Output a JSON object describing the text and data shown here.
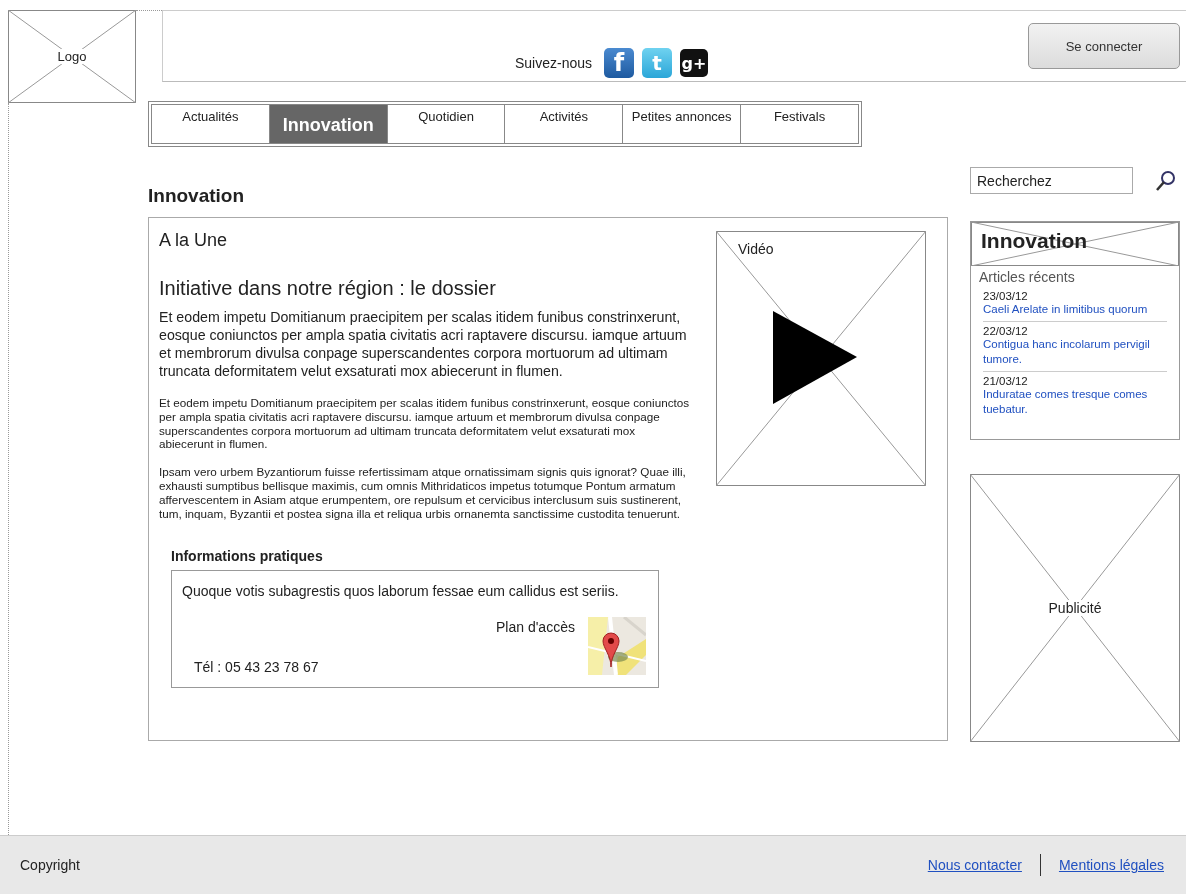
{
  "header": {
    "logo": "Logo",
    "follow_label": "Suivez-nous",
    "social": [
      {
        "kind": "facebook",
        "glyph": "f"
      },
      {
        "kind": "twitter",
        "glyph": "t"
      },
      {
        "kind": "googleplus",
        "glyph": "g+"
      }
    ],
    "login_button": "Se connecter"
  },
  "nav": {
    "tabs": [
      {
        "label": "Actualités",
        "selected": false
      },
      {
        "label": "Innovation",
        "selected": true
      },
      {
        "label": "Quotidien",
        "selected": false
      },
      {
        "label": "Activités",
        "selected": false
      },
      {
        "label": "Petites annonces",
        "selected": false
      },
      {
        "label": "Festivals",
        "selected": false
      }
    ]
  },
  "page_title": "Innovation",
  "main": {
    "section": "A la Une",
    "headline": "Initiative dans notre région : le dossier",
    "lead": "Et eodem impetu Domitianum praecipitem per scalas itidem funibus constrinxerunt, eosque coniunctos per ampla spatia civitatis acri raptavere discursu. iamque artuum et membrorum divulsa conpage superscandentes corpora mortuorum ad ultimam truncata deformitatem velut exsaturati mox abiecerunt in flumen.",
    "paragraphs": [
      "Et eodem impetu Domitianum praecipitem per scalas itidem funibus constrinxerunt, eosque coniunctos per ampla spatia civitatis acri raptavere discursu. iamque artuum et membrorum divulsa conpage superscandentes corpora mortuorum ad ultimam truncata deformitatem velut exsaturati mox abiecerunt in flumen.",
      "Ipsam vero urbem Byzantiorum fuisse refertissimam atque ornatissimam signis quis ignorat? Quae illi, exhausti sumptibus bellisque maximis, cum omnis Mithridaticos impetus totumque Pontum armatum affervescentem in Asiam atque erumpentem, ore repulsum et cervicibus interclusum suis sustinerent, tum, inquam, Byzantii et postea signa illa et reliqua urbis ornanemta sanctissime custodita tenuerunt."
    ],
    "video_label": "Vidéo",
    "info": {
      "title": "Informations pratiques",
      "text": "Quoque votis subagrestis quos laborum fessae eum callidus est seriis.",
      "map_label": "Plan d'accès",
      "phone": "Tél : 05 43 23 78 67"
    }
  },
  "sidebar": {
    "search": {
      "placeholder": "Recherchez"
    },
    "card": {
      "title": "Innovation",
      "subtitle": "Articles récents",
      "articles": [
        {
          "date": "23/03/12",
          "title": "Caeli Arelate in limitibus quorum"
        },
        {
          "date": "22/03/12",
          "title": "Contigua hanc incolarum pervigil tumore."
        },
        {
          "date": "21/03/12",
          "title": "Induratae comes tresque comes tuebatur."
        }
      ]
    },
    "ad_label": "Publicité"
  },
  "footer": {
    "copyright": "Copyright",
    "links": [
      "Nous contacter",
      "Mentions légales"
    ]
  }
}
